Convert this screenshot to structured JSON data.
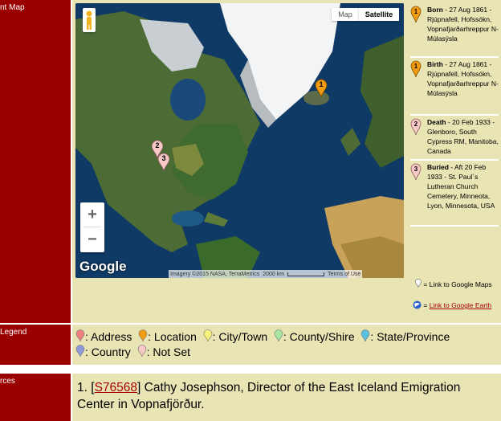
{
  "labels": {
    "map": "nt Map",
    "legend": "Legend",
    "sources": "rces"
  },
  "map": {
    "type_buttons": {
      "map": "Map",
      "satellite": "Satellite"
    },
    "zoom_in": "+",
    "zoom_out": "−",
    "logo": "Google",
    "attribution": "Imagery ©2015 NASA, TerraMetrics",
    "scale": "2000 km",
    "terms": "Terms of Use",
    "pins": [
      {
        "number": "1",
        "color": "#f39c12"
      },
      {
        "number": "2",
        "color": "#f8c8c8"
      },
      {
        "number": "3",
        "color": "#f8c8c8"
      }
    ]
  },
  "events": [
    {
      "number": "1",
      "color": "#f39c12",
      "kind": "Born",
      "date": " - 27 Aug 1861",
      "place": "- Rjúpnafell, Hofssókn, Vopnafjarðarhreppur N-Múlasýsla"
    },
    {
      "number": "1",
      "color": "#f39c12",
      "kind": "Birth",
      "date": " - 27 Aug 1861",
      "place": "- Rjúpnafell, Hofssókn, Vopnafjarðarhreppur N-Múlasýsla"
    },
    {
      "number": "2",
      "color": "#f8c8c8",
      "kind": "Death",
      "date": " - 20 Feb 1933",
      "place": "- Glenboro, South Cypress RM, Manitoba, Canada"
    },
    {
      "number": "3",
      "color": "#f8c8c8",
      "kind": "Buried",
      "date": " - Aft 20 Feb 1933",
      "place": "- St. Paul´s Lutheran Church Cemetery, Minneota, Lyon, Minnesota, USA"
    }
  ],
  "links": {
    "google_maps": " = Link to Google Maps",
    "google_earth_prefix": " = ",
    "google_earth": "Link to Google Earth"
  },
  "legend": [
    {
      "label": ": Address",
      "color": "#f08080"
    },
    {
      "label": ": Location",
      "color": "#f39c12"
    },
    {
      "label": ": City/Town",
      "color": "#f7f07a"
    },
    {
      "label": ": County/Shire",
      "color": "#a8e6a3"
    },
    {
      "label": ":",
      "color": "#5bc0de"
    },
    {
      "label": "State/Province",
      "color": null
    },
    {
      "label": ": Country",
      "color": "#8e9ad8"
    },
    {
      "label": ": Not Set",
      "color": "#f8c8c8"
    }
  ],
  "sources": {
    "number": "1.",
    "link": "S76568",
    "text": " Cathy Josephson, Director of the East Iceland Emigration Center in Vopnafjörður."
  }
}
